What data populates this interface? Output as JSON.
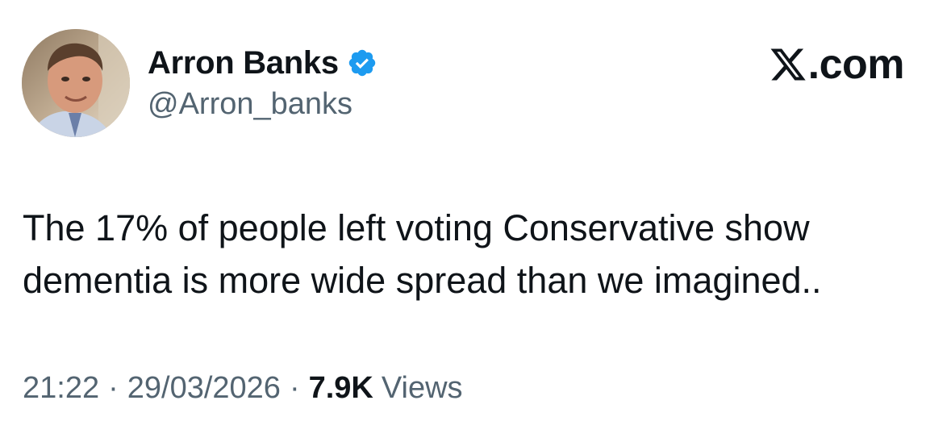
{
  "author": {
    "display_name": "Arron Banks",
    "handle": "@Arron_banks",
    "verified": true,
    "verified_color": "#1d9bf0",
    "avatar_icon": "profile-photo"
  },
  "brand": {
    "icon": "x-logo-icon",
    "text": ".com"
  },
  "tweet": {
    "text": "The 17% of people left voting Conservative show\ndementia is more wide spread than we imagined.."
  },
  "meta": {
    "time": "21:22",
    "separator": "·",
    "date": "29/03/2026",
    "views_count": "7.9K",
    "views_label": "Views"
  },
  "colors": {
    "text_primary": "#0f1419",
    "text_secondary": "#536471",
    "background": "#ffffff"
  }
}
